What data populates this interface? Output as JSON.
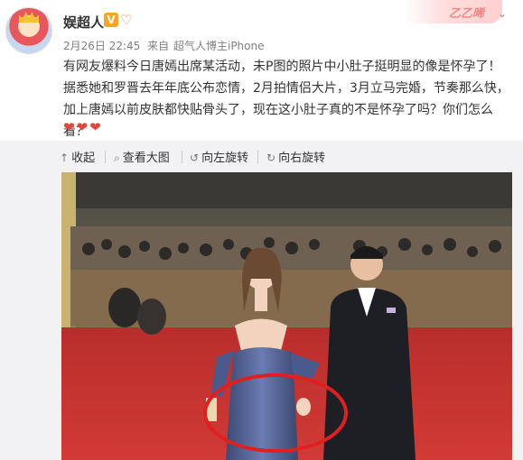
{
  "user": {
    "name": "娱超人",
    "verified_badge": "V",
    "fan_badge": "heart-hand-badge"
  },
  "meta": {
    "date": "2月26日 22:45",
    "source_prefix": "来自",
    "source": "超气人博主iPhone"
  },
  "decoration": {
    "ribbon_text": "乙乙晞"
  },
  "post": {
    "text": "有网友爆料今日唐嫣出席某活动，未P图的照片中小肚子挺明显的像是怀孕了！据悉她和罗晋去年年底公布恋情，2月拍情侣大片，3月立马完婚，节奏那么快，加上唐嫣以前皮肤都快贴骨头了，现在这小肚子真的不是怀孕了吗？你们怎么看？",
    "hearts": "❤❤❤"
  },
  "toolbar": {
    "collapse": "收起",
    "view_large": "查看大图",
    "rotate_left": "向左旋转",
    "rotate_right": "向右旋转"
  },
  "icons": {
    "collapse": "arrow-up-icon",
    "view_large": "magnifier-icon",
    "rotate_left": "rotate-left-icon",
    "rotate_right": "rotate-right-icon"
  },
  "colors": {
    "carpet": "#c8312f",
    "circle": "#e02020",
    "dress": "#4a5a8c",
    "suit": "#1d1f24"
  }
}
